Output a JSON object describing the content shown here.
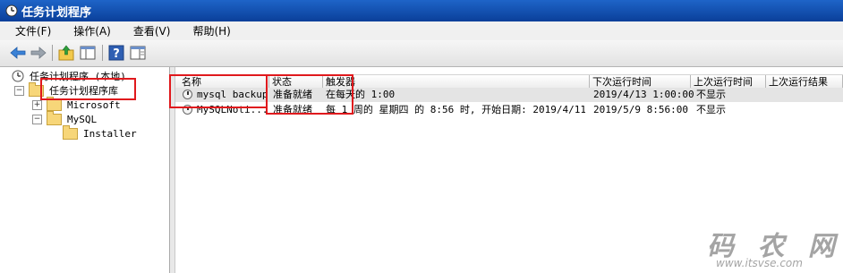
{
  "window": {
    "title": "任务计划程序"
  },
  "menu": {
    "file": "文件(F)",
    "action": "操作(A)",
    "view": "查看(V)",
    "help": "帮助(H)"
  },
  "toolbar": {
    "buttons": [
      "back-arrow-icon",
      "forward-arrow-icon",
      "up-folder-icon",
      "show-pane-icon",
      "help-icon",
      "properties-icon"
    ]
  },
  "tree": {
    "root": "任务计划程序 (本地)",
    "library": "任务计划程序库",
    "microsoft": "Microsoft",
    "mysql": "MySQL",
    "installer": "Installer",
    "expand_glyph": "+",
    "collapse_glyph": "−"
  },
  "table": {
    "headers": [
      "名称",
      "状态",
      "触发器",
      "下次运行时间",
      "上次运行时间",
      "上次运行结果"
    ],
    "rows": [
      {
        "name": "mysql backup",
        "status": "准备就绪",
        "trigger": "在每天的 1:00",
        "next_run": "2019/4/13 1:00:00",
        "last_run": "不显示"
      },
      {
        "name": "MySQLNoti...",
        "status": "准备就绪",
        "trigger": "每 1 周的 星期四 的 8:56 时, 开始日期: 2019/4/11",
        "next_run": "2019/5/9 8:56:00",
        "last_run": "不显示"
      }
    ]
  },
  "watermark": {
    "main": "码 农 网",
    "url": "www.itsvse.com"
  },
  "colors": {
    "title_bar": "#0a3f99",
    "highlight_box": "#e0191d"
  }
}
